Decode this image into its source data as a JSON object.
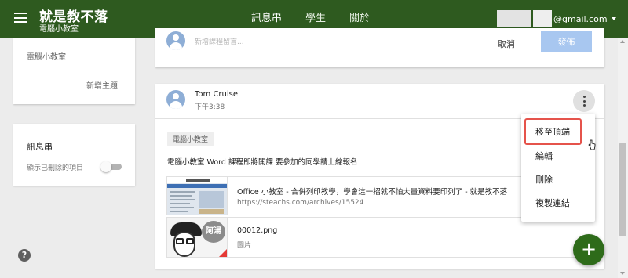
{
  "header": {
    "title": "就是教不落",
    "subtitle": "電腦小教室",
    "tabs": [
      {
        "label": "訊息串",
        "active": true
      },
      {
        "label": "學生",
        "active": false
      },
      {
        "label": "關於",
        "active": false
      }
    ],
    "account_email": "@gmail.com"
  },
  "sidebar": {
    "topic_item": "電腦小教室",
    "new_topic_label": "新增主題",
    "stream_title": "訊息串",
    "show_deleted_label": "顯示已刪除的項目",
    "show_deleted_on": false
  },
  "composer": {
    "placeholder": "新增課程留言...",
    "cancel_label": "取消",
    "post_label": "發佈"
  },
  "post": {
    "author": "Tom Cruise",
    "time": "下午3:38",
    "topic_chip": "電腦小教室",
    "body": "電腦小教室 Word 課程即將開課 要參加的同學請上線報名",
    "attachments": [
      {
        "title": "Office 小教室 - 合併列印教學，學會這一招就不怕大量資料要印列了 - 就是教不落",
        "subtitle": "https://steachs.com/archives/15524",
        "thumb_text": ""
      },
      {
        "title": "00012.png",
        "subtitle": "圖片",
        "thumb_text": "阿湯"
      }
    ]
  },
  "context_menu": {
    "items": [
      "移至頂端",
      "編輯",
      "刪除",
      "複製連結"
    ],
    "highlighted_index": 0
  },
  "colors": {
    "header_bg": "#2e5a1f",
    "fab_bg": "#2e6b1a",
    "post_button_bg": "#a8c7f0",
    "highlight_border": "#e5534b"
  }
}
